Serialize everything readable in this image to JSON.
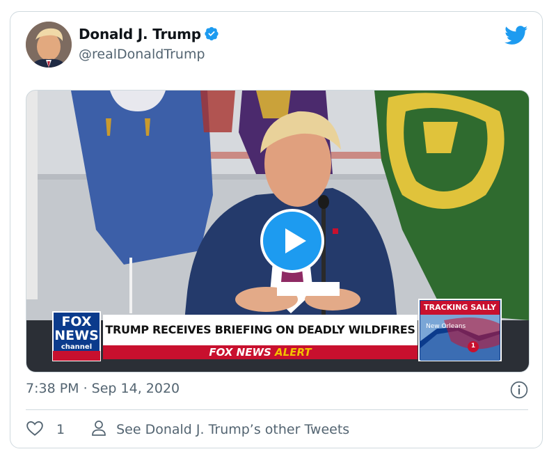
{
  "tweet": {
    "author_name": "Donald J. Trump",
    "author_handle": "@realDonaldTrump",
    "timestamp": "7:38 PM · Sep 14, 2020",
    "like_count": "1",
    "other_tweets_label": "See Donald J. Trump’s other Tweets"
  },
  "video": {
    "headline": "TRUMP RECEIVES BRIEFING ON DEADLY WILDFIRES",
    "alert_prefix": "FOX NEWS",
    "alert_suffix": "ALERT",
    "logo_line1": "FOX",
    "logo_line2": "NEWS",
    "logo_line3": "channel",
    "tracking_title": "TRACKING SALLY",
    "map_label": "New Orleans",
    "storm_number": "1"
  },
  "icons": {
    "verified": "verified-badge-icon",
    "platform": "twitter-bird-icon",
    "play": "play-icon",
    "info": "info-icon",
    "like": "heart-icon",
    "profile": "person-icon"
  },
  "colors": {
    "accent": "#1d9bf0",
    "text_primary": "#0f1419",
    "text_secondary": "#536471",
    "border": "#cfd9de",
    "fox_red": "#c8102e",
    "fox_blue": "#0b3b8c"
  }
}
